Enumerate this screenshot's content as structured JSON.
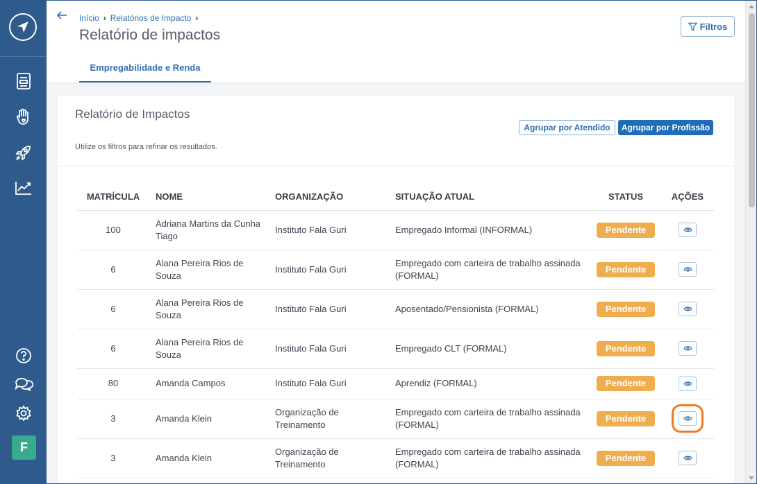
{
  "sidebar": {
    "logo": "compass-logo",
    "top_icons": [
      "document-icon",
      "hand-heart-icon",
      "rocket-icon",
      "chart-line-icon"
    ],
    "bottom_icons": [
      "help-icon",
      "chat-icon",
      "gear-icon"
    ],
    "avatar_letter": "F",
    "avatar_color": "#3aaa8c",
    "bg_color": "#2f5a8c"
  },
  "header": {
    "breadcrumb": [
      "Início",
      "Relatórios de Impacto"
    ],
    "title": "Relatório de impactos",
    "filters_label": "Filtros",
    "tab_label": "Empregabilidade e Renda"
  },
  "card": {
    "title": "Relatório de Impactos",
    "subtitle": "Utilize os filtros para refinar os resultados.",
    "group_by_attended": "Agrupar por Atendido",
    "group_by_profession": "Agrupar por Profissão"
  },
  "table": {
    "headers": [
      "MATRÍCULA",
      "NOME",
      "ORGANIZAÇÃO",
      "SITUAÇÃO ATUAL",
      "STATUS",
      "AÇÕES"
    ],
    "rows": [
      {
        "matricula": "100",
        "nome": "Adriana Martins da Cunha Tiago",
        "org": "Instituto Fala Guri",
        "situacao": "Empregado Informal (INFORMAL)",
        "status": "Pendente"
      },
      {
        "matricula": "6",
        "nome": "Alana Pereira Rios de Souza",
        "org": "Instituto Fala Guri",
        "situacao": "Empregado com carteira de trabalho assinada (FORMAL)",
        "status": "Pendente"
      },
      {
        "matricula": "6",
        "nome": "Alana Pereira Rios de Souza",
        "org": "Instituto Fala Guri",
        "situacao": "Aposentado/Pensionista (FORMAL)",
        "status": "Pendente"
      },
      {
        "matricula": "6",
        "nome": "Alana Pereira Rios de Souza",
        "org": "Instituto Fala Guri",
        "situacao": "Empregado CLT (FORMAL)",
        "status": "Pendente"
      },
      {
        "matricula": "80",
        "nome": "Amanda Campos",
        "org": "Instituto Fala Guri",
        "situacao": "Aprendiz (FORMAL)",
        "status": "Pendente"
      },
      {
        "matricula": "3",
        "nome": "Amanda Klein",
        "org": "Organização de Treinamento",
        "situacao": "Empregado com carteira de trabalho assinada (FORMAL)",
        "status": "Pendente"
      },
      {
        "matricula": "3",
        "nome": "Amanda Klein",
        "org": "Organização de Treinamento",
        "situacao": "Empregado com carteira de trabalho assinada (FORMAL)",
        "status": "Pendente"
      }
    ],
    "highlighted_row": 5,
    "status_color": "#f0ad4e",
    "highlight_color": "#f07a22"
  }
}
